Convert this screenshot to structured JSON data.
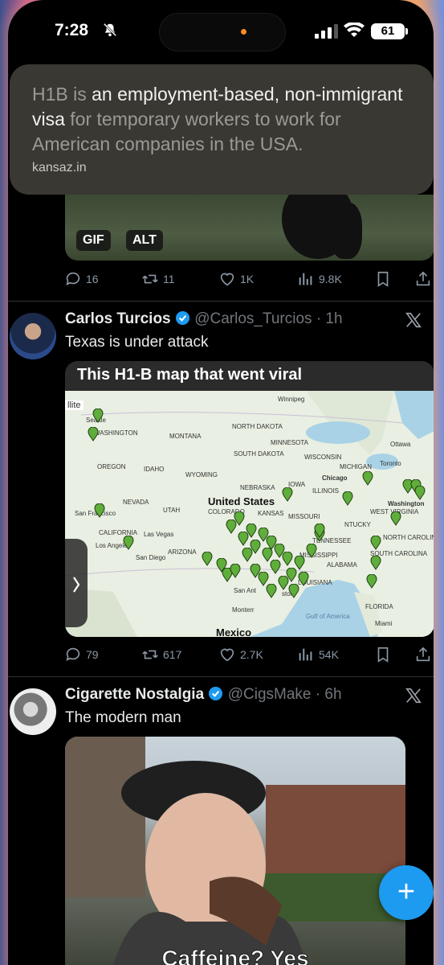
{
  "status_bar": {
    "time": "7:28",
    "battery": "61"
  },
  "context_card": {
    "text_pre": "H1B",
    "text_mid1": " is ",
    "text_hl1": "an employment-based, non-immigrant visa",
    "text_mid2": " for temporary workers to work for American companies in the USA.",
    "source": "kansaz.in"
  },
  "tweet0": {
    "badges": [
      "GIF",
      "ALT"
    ],
    "actions": {
      "replies": "16",
      "reposts": "11",
      "likes": "1K",
      "views": "9.8K"
    }
  },
  "tweet1": {
    "name": "Carlos Turcios",
    "handle": "@Carlos_Turcios",
    "time": "· 1h",
    "text": "Texas is under attack",
    "media_title": "This H1-B map that went viral",
    "map_labels": {
      "us": "United States",
      "mexico": "Mexico",
      "winnipeg": "Winnipeg",
      "ottawa": "Ottawa",
      "toronto": "Toronto",
      "chicago": "Chicago",
      "washington": "Washington",
      "san_francisco": "San Francisco",
      "las_vegas": "Las Vegas",
      "los_angeles": "Los Angeles",
      "san_diego": "San Diego",
      "miami": "Miami",
      "seattle": "Seattle",
      "satellite": "llite",
      "gulf": "Gulf of America",
      "monterrey": "Monterr",
      "san_antonio": "San Ant",
      "houston": "ston",
      "montana": "MONTANA",
      "oregon": "OREGON",
      "idaho": "IDAHO",
      "wyoming": "WYOMING",
      "nevada": "NEVADA",
      "utah": "UTAH",
      "colorado": "COLORADO",
      "california": "CALIFORNIA",
      "arizona": "ARIZONA",
      "nebraska": "NEBRASKA",
      "iowa": "IOWA",
      "kansas": "KANSAS",
      "missouri": "MISSOURI",
      "illinois": "ILLINOIS",
      "tennessee": "TENNESSEE",
      "mississippi": "MISSISSIPPI",
      "alabama": "ALABAMA",
      "louisiana": "LOUISIANA",
      "florida": "FLORIDA",
      "minnesota": "MINNESOTA",
      "wisconsin": "WISCONSIN",
      "michigan": "MICHIGAN",
      "north_dakota": "NORTH DAKOTA",
      "south_dakota": "SOUTH DAKOTA",
      "washington_state": "WASHINGTON",
      "north_carolina": "NORTH CAROLINA",
      "south_carolina": "SOUTH CAROLINA",
      "kentucky": "NTUCKY",
      "west_virginia": "WEST VIRGINIA"
    },
    "actions": {
      "replies": "79",
      "reposts": "617",
      "likes": "2.7K",
      "views": "54K"
    }
  },
  "tweet2": {
    "name": "Cigarette Nostalgia",
    "handle": "@CigsMake",
    "time": "· 6h",
    "text": "The modern man",
    "caption": "Caffeine? Yes"
  },
  "fab": {
    "label": "+"
  },
  "colors": {
    "accent": "#1d9bf0",
    "verified": "#1d9bf0",
    "pin": "#5fae3b"
  }
}
